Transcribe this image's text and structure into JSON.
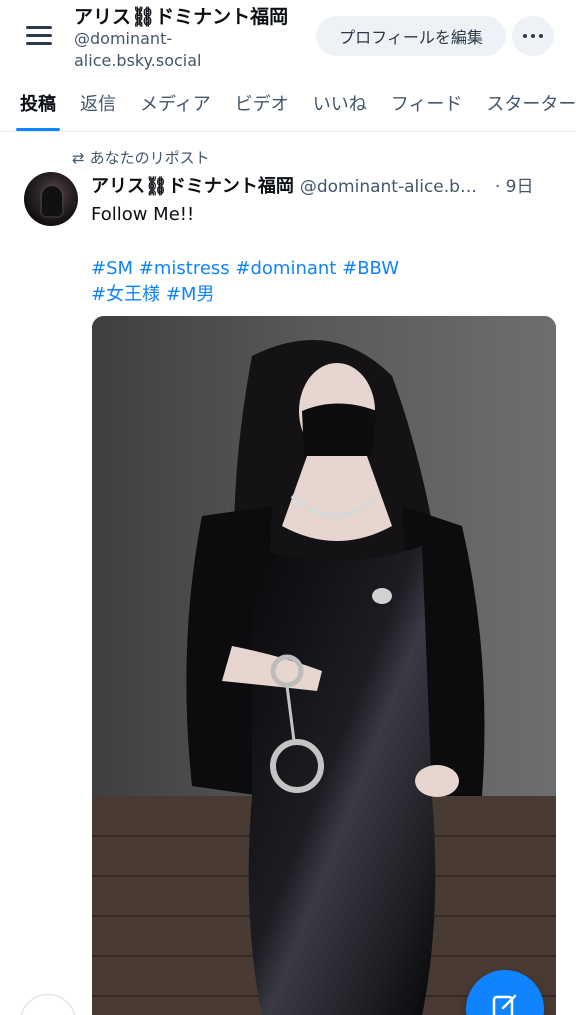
{
  "header": {
    "display_name": "アリス⛓ドミナント福岡",
    "handle": "@dominant-alice.bsky.social",
    "edit_profile_label": "プロフィールを編集",
    "menu_icon": "hamburger-icon",
    "more_icon": "ellipsis-icon"
  },
  "tabs": [
    {
      "label": "投稿",
      "active": true
    },
    {
      "label": "返信",
      "active": false
    },
    {
      "label": "メディア",
      "active": false
    },
    {
      "label": "ビデオ",
      "active": false
    },
    {
      "label": "いいね",
      "active": false
    },
    {
      "label": "フィード",
      "active": false
    },
    {
      "label": "スターター",
      "active": false
    }
  ],
  "post": {
    "repost_label": "あなたのリポスト",
    "author": "アリス⛓ドミナント福岡",
    "handle": "@dominant-alice.bsky.social",
    "time": "· 9日",
    "text": "Follow Me!!",
    "hashtags_line1": [
      "#SM",
      "#mistress",
      "#dominant",
      "#BBW"
    ],
    "hashtags_line2": [
      "#女王様",
      "#M男"
    ],
    "image_description_icon": "photo"
  },
  "fab": {
    "icon": "compose-icon"
  },
  "colors": {
    "accent": "#1083fe",
    "muted": "#42576c",
    "chip": "#eef1f5"
  }
}
